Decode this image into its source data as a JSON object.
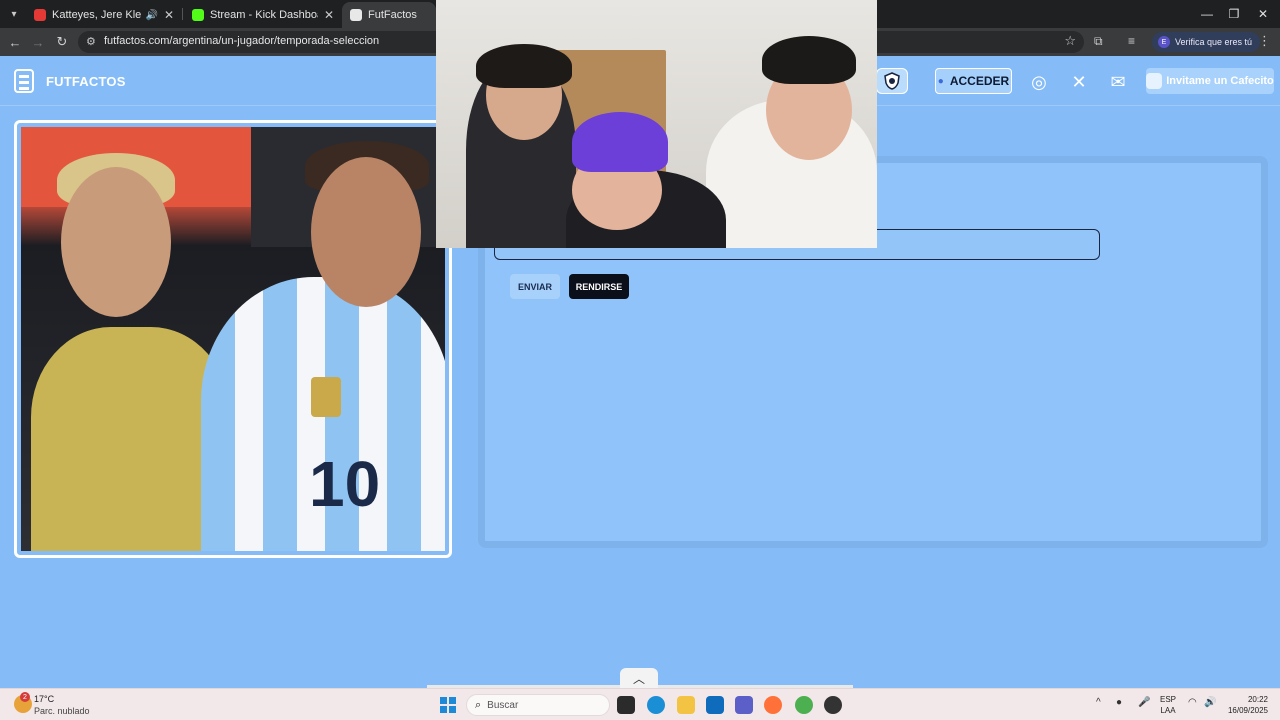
{
  "browser": {
    "tabs": [
      {
        "label": "Katteyes, Jere Klein, Lucky B",
        "favicon_color": "#e53935",
        "muted_icon": "speaker-icon",
        "active": false
      },
      {
        "label": "Stream - Kick Dashboard",
        "favicon_color": "#53fc18",
        "active": false
      },
      {
        "label": "FutFactos",
        "favicon_color": "#e8e8e8",
        "active": true
      }
    ],
    "url": "futfactos.com/argentina/un-jugador/temporada-seleccion",
    "profile_button": "Verifica que eres tú",
    "profile_initial": "E"
  },
  "site": {
    "logo_text": "FUTFACTOS",
    "login_label": "ACCEDER",
    "cafecito_label": "Invitame un Cafecito",
    "social": [
      {
        "name": "instagram",
        "glyph": "◎"
      },
      {
        "name": "x",
        "glyph": "✕"
      },
      {
        "name": "mail",
        "glyph": "✉"
      }
    ]
  },
  "game": {
    "answer_value": "",
    "send_label": "ENVIAR",
    "give_up_label": "RENDIRSE",
    "photo_number": "10"
  },
  "taskbar": {
    "badge": "2",
    "temp": "17°C",
    "weather": "Parc. nublado",
    "search_placeholder": "Buscar",
    "lang_top": "ESP",
    "lang_bottom": "LAA",
    "time": "20:22",
    "date": "16/09/2025"
  },
  "colors": {
    "page_bg": "#85bcf7",
    "panel_bg": "#90c3f9",
    "give_up_bg": "#0b0f1a"
  }
}
